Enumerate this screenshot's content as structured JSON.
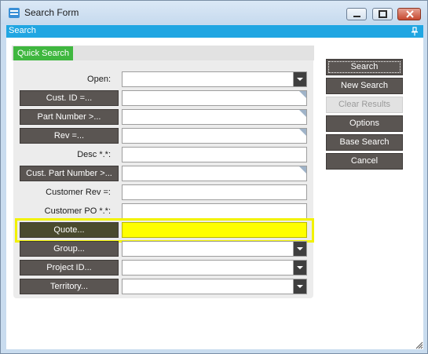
{
  "window": {
    "title": "Search Form"
  },
  "panel": {
    "title": "Search"
  },
  "tabs": [
    {
      "label": "Quick Search",
      "active": true
    }
  ],
  "fields": [
    {
      "label": "Open:",
      "kind": "label",
      "input": "dropdown",
      "value": ""
    },
    {
      "label": "Cust. ID =...",
      "kind": "button",
      "input": "text",
      "value": ""
    },
    {
      "label": "Part Number >...",
      "kind": "button",
      "input": "text",
      "value": ""
    },
    {
      "label": "Rev =...",
      "kind": "button",
      "input": "text",
      "value": ""
    },
    {
      "label": "Desc *.*:",
      "kind": "label",
      "input": "text",
      "value": ""
    },
    {
      "label": "Cust. Part Number >...",
      "kind": "button",
      "input": "text",
      "value": ""
    },
    {
      "label": "Customer Rev =:",
      "kind": "label",
      "input": "text",
      "value": ""
    },
    {
      "label": "Customer PO *.*:",
      "kind": "label",
      "input": "text",
      "value": ""
    },
    {
      "label": "Quote...",
      "kind": "button",
      "input": "text",
      "value": "",
      "highlighted": true
    },
    {
      "label": "Group...",
      "kind": "button",
      "input": "dropdown",
      "value": ""
    },
    {
      "label": "Project ID...",
      "kind": "button",
      "input": "dropdown",
      "value": ""
    },
    {
      "label": "Territory...",
      "kind": "button",
      "input": "dropdown",
      "value": ""
    }
  ],
  "actions": [
    {
      "label": "Search",
      "enabled": true,
      "primary": true
    },
    {
      "label": "New Search",
      "enabled": true
    },
    {
      "label": "Clear Results",
      "enabled": false
    },
    {
      "label": "Options",
      "enabled": true
    },
    {
      "label": "Base Search",
      "enabled": true
    },
    {
      "label": "Cancel",
      "enabled": true
    }
  ],
  "colors": {
    "panel_bar": "#20a6e2",
    "tab_active": "#3fb73f",
    "button_dark": "#5a5552",
    "highlight": "#ffff00"
  }
}
